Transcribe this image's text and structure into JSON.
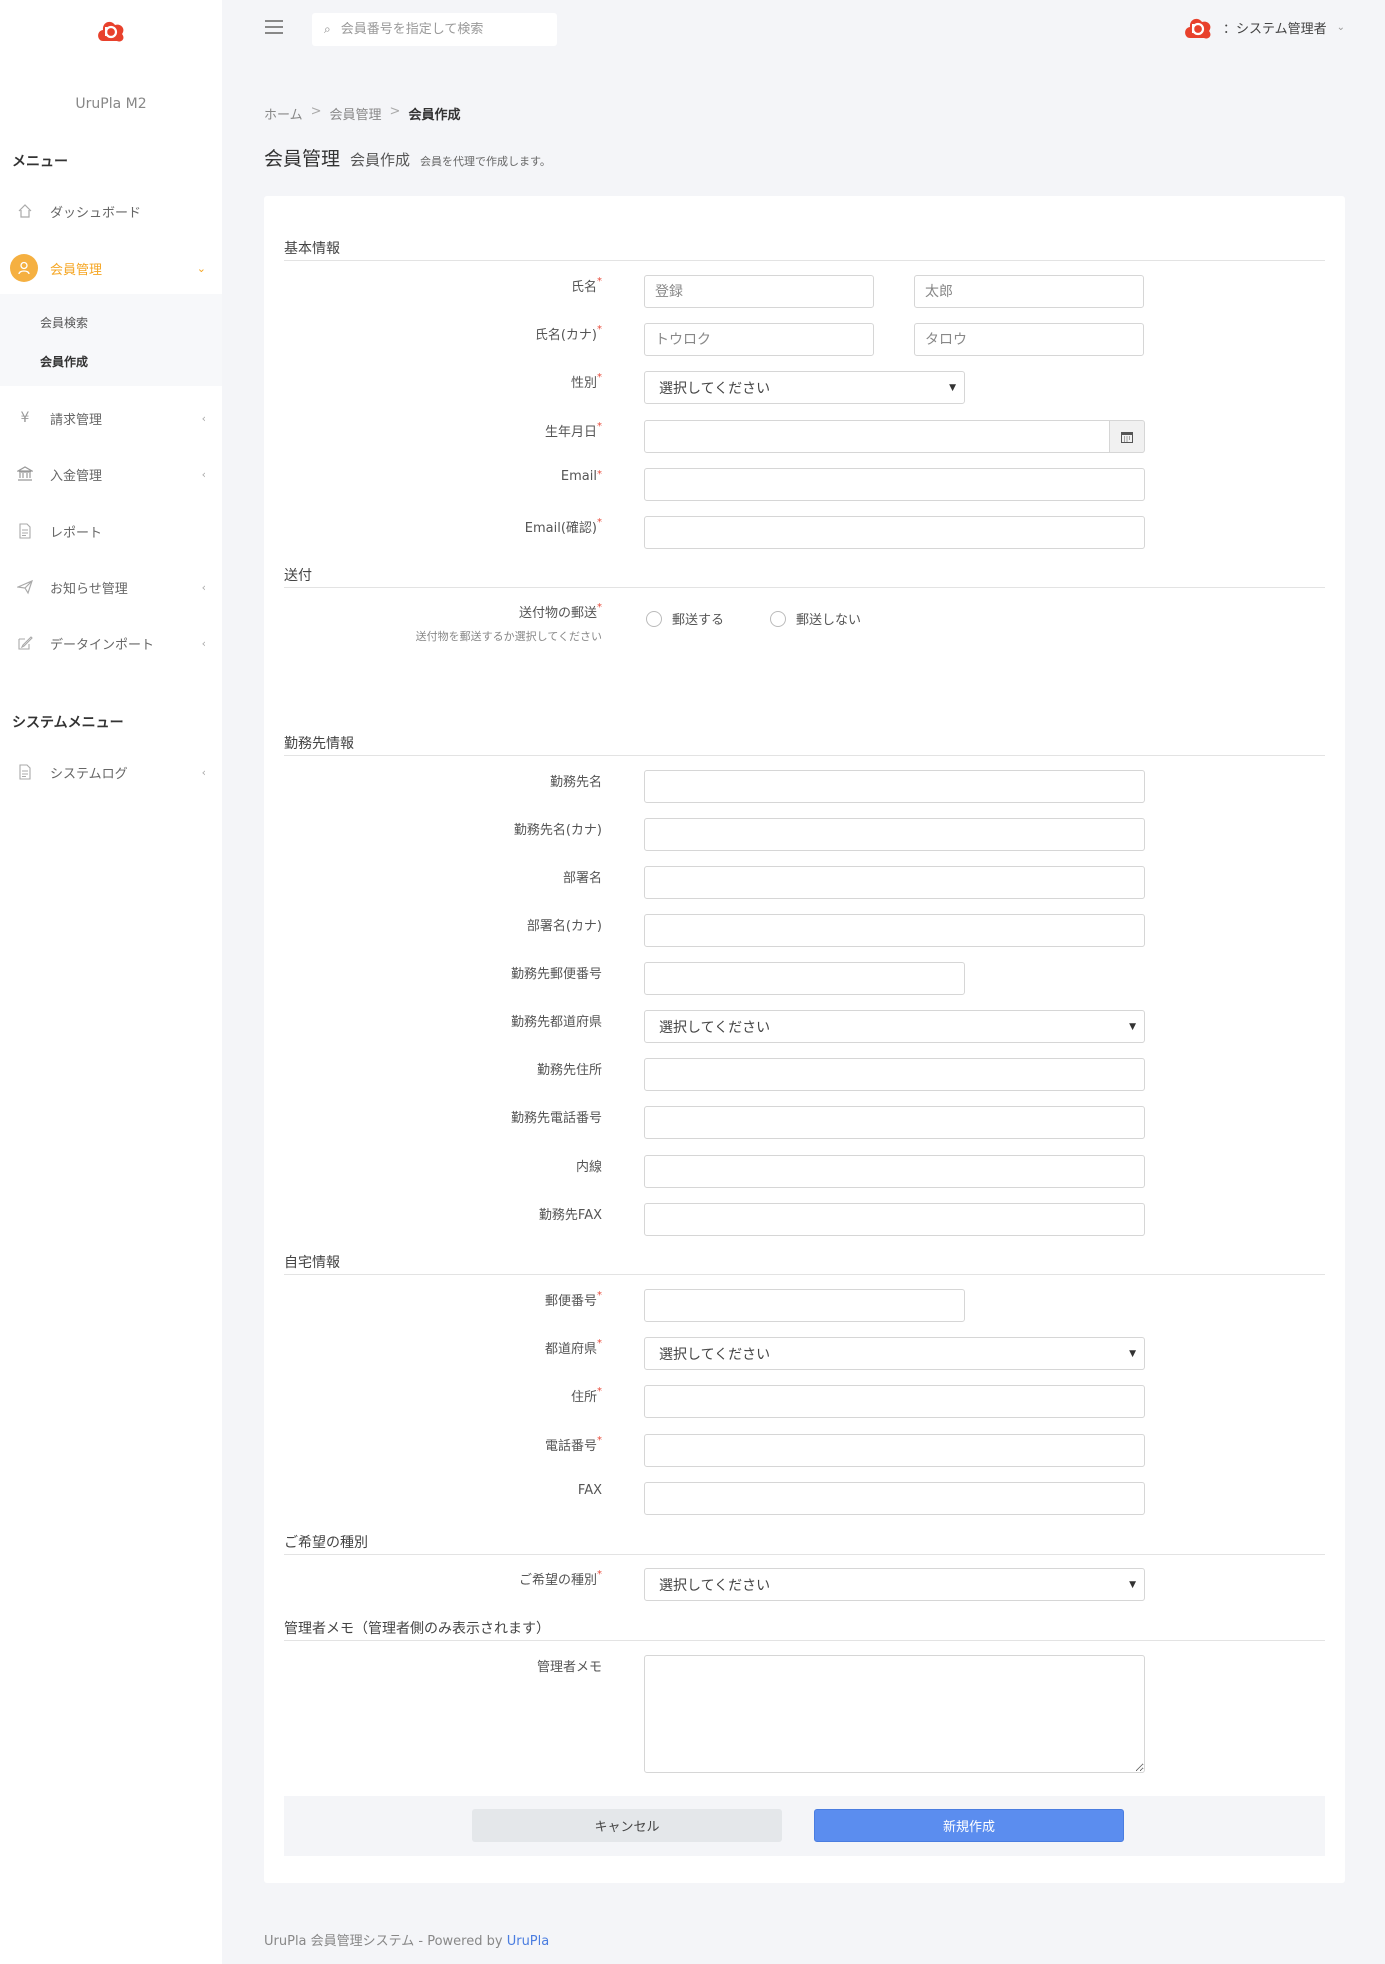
{
  "sidebar": {
    "brand": "UruPla M2",
    "menu_head": "メニュー",
    "system_head": "システムメニュー",
    "items": [
      {
        "label": "ダッシュボード",
        "icon": "home-icon"
      },
      {
        "label": "会員管理",
        "icon": "user-icon"
      },
      {
        "label": "請求管理",
        "icon": "yen-icon"
      },
      {
        "label": "入金管理",
        "icon": "bank-icon"
      },
      {
        "label": "レポート",
        "icon": "document-icon"
      },
      {
        "label": "お知らせ管理",
        "icon": "paper-plane-icon"
      },
      {
        "label": "データインポート",
        "icon": "edit-icon"
      },
      {
        "label": "システムログ",
        "icon": "document-icon"
      }
    ],
    "submenu": [
      {
        "label": "会員検索"
      },
      {
        "label": "会員作成"
      }
    ],
    "accent": "#f5a623"
  },
  "topbar": {
    "search_placeholder": "会員番号を指定して検索",
    "user_name": "：システム管理者"
  },
  "breadcrumb": {
    "home": "ホーム",
    "sep": ">",
    "parent": "会員管理",
    "current": "会員作成"
  },
  "page": {
    "title": "会員管理",
    "subtitle": "会員作成",
    "description": "会員を代理で作成します。"
  },
  "form": {
    "required_mark": "*",
    "sections": {
      "basic": "基本情報",
      "delivery": "送付",
      "work": "勤務先情報",
      "home": "自宅情報",
      "preference": "ご希望の種別",
      "memo": "管理者メモ（管理者側のみ表示されます）"
    },
    "labels": {
      "name": "氏名",
      "name_kana": "氏名(カナ)",
      "gender": "性別",
      "birthday": "生年月日",
      "email": "Email",
      "email_confirm": "Email(確認)",
      "mail_delivery": "送付物の郵送",
      "mail_delivery_hint": "送付物を郵送するか選択してください",
      "work_name": "勤務先名",
      "work_name_kana": "勤務先名(カナ)",
      "dept_name": "部署名",
      "dept_name_kana": "部署名(カナ)",
      "work_zip": "勤務先郵便番号",
      "work_pref": "勤務先都道府県",
      "work_address": "勤務先住所",
      "work_phone": "勤務先電話番号",
      "extension": "内線",
      "work_fax": "勤務先FAX",
      "zip": "郵便番号",
      "pref": "都道府県",
      "address": "住所",
      "phone": "電話番号",
      "fax": "FAX",
      "preference": "ご希望の種別",
      "memo": "管理者メモ"
    },
    "placeholders": {
      "last_name": "登録",
      "first_name": "太郎",
      "last_name_kana": "トウロク",
      "first_name_kana": "タロウ"
    },
    "select_default": "選択してください",
    "radio": {
      "send": "郵送する",
      "no_send": "郵送しない"
    },
    "buttons": {
      "cancel": "キャンセル",
      "create": "新規作成"
    }
  },
  "footer": {
    "text": "UruPla 会員管理システム - Powered by ",
    "link": "UruPla"
  },
  "colors": {
    "primary": "#5b8def",
    "required": "#e74c3c",
    "logo": "#e8412c"
  }
}
